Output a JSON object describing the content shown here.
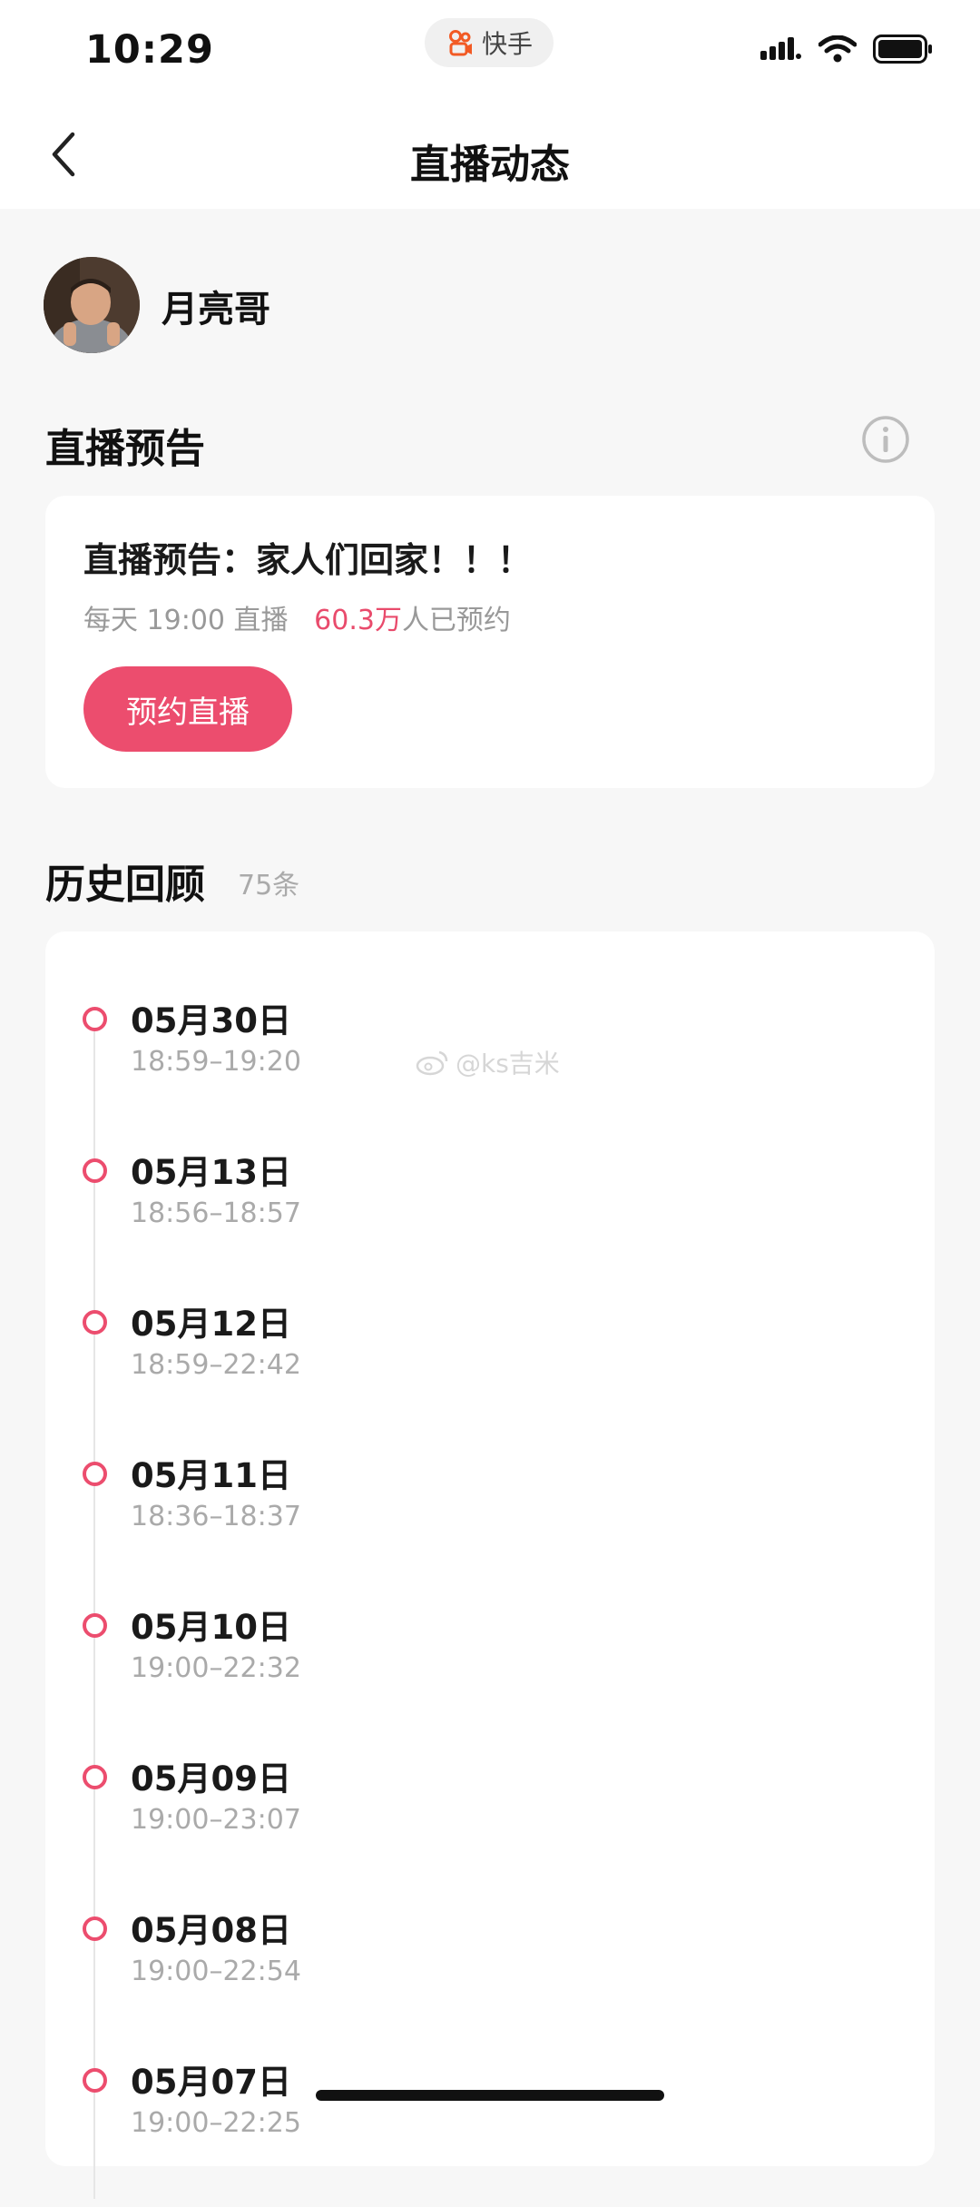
{
  "status_bar": {
    "time": "10:29",
    "app_name": "快手",
    "signal_icon": "signal-icon",
    "wifi_icon": "wifi-icon",
    "battery_icon": "battery-icon"
  },
  "nav": {
    "back_icon": "chevron-left-icon",
    "title": "直播动态"
  },
  "profile": {
    "name": "月亮哥"
  },
  "live_notice_section": {
    "title": "直播预告",
    "info_icon": "info-icon"
  },
  "notice_card": {
    "title": "直播预告：家人们回家！！！",
    "schedule": "每天 19:00 直播",
    "reserve_count": "60.3万",
    "reserve_suffix": "人已预约",
    "button_label": "预约直播"
  },
  "history_section": {
    "title": "历史回顾",
    "count": "75条",
    "items": [
      {
        "date": "05月30日",
        "time": "18:59–19:20"
      },
      {
        "date": "05月13日",
        "time": "18:56–18:57"
      },
      {
        "date": "05月12日",
        "time": "18:59–22:42"
      },
      {
        "date": "05月11日",
        "time": "18:36–18:37"
      },
      {
        "date": "05月10日",
        "time": "19:00–22:32"
      },
      {
        "date": "05月09日",
        "time": "19:00–23:07"
      },
      {
        "date": "05月08日",
        "time": "19:00–22:54"
      },
      {
        "date": "05月07日",
        "time": "19:00–22:25"
      }
    ]
  },
  "watermark": "@ks吉米",
  "colors": {
    "accent": "#ec4d6e",
    "background": "#f7f7f7",
    "card": "#ffffff"
  }
}
